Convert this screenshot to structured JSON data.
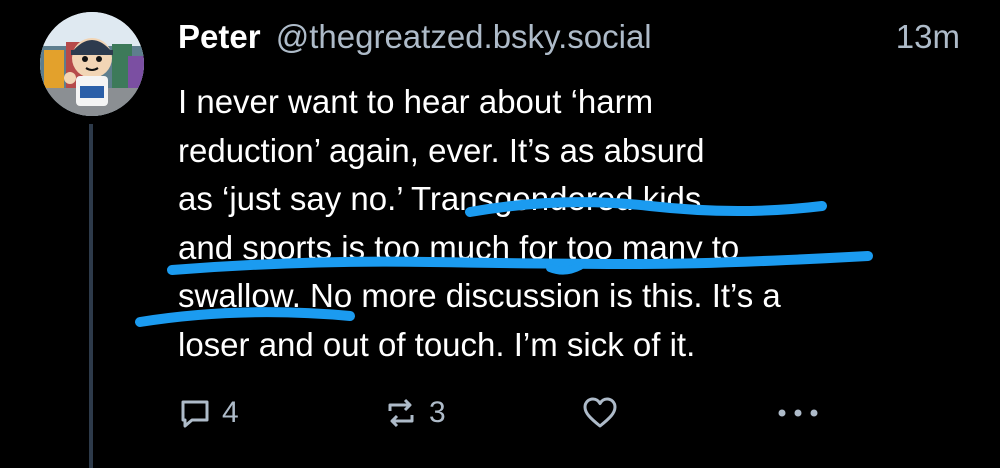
{
  "post": {
    "author": {
      "display_name": "Peter",
      "handle": "@thegreatzed.bsky.social"
    },
    "timestamp": "13m",
    "text_lines": [
      "I never want to hear about ‘harm",
      "reduction’ again, ever. It’s as absurd",
      "as ‘just say no.’ Transgendered kids",
      "and sports is too much for too many to",
      "swallow. No more discussion is this. It’s a",
      "loser and out of touch. I’m sick of it."
    ],
    "actions": {
      "reply_count": "4",
      "repost_count": "3",
      "like_count": "",
      "reply_icon": "reply-icon",
      "repost_icon": "repost-icon",
      "like_icon": "heart-icon",
      "more_icon": "more-icon"
    }
  },
  "colors": {
    "background": "#000000",
    "text": "#ffffff",
    "muted": "#aebbc9",
    "thread_line": "#2d3a4a",
    "highlight": "#1b9bf0"
  }
}
